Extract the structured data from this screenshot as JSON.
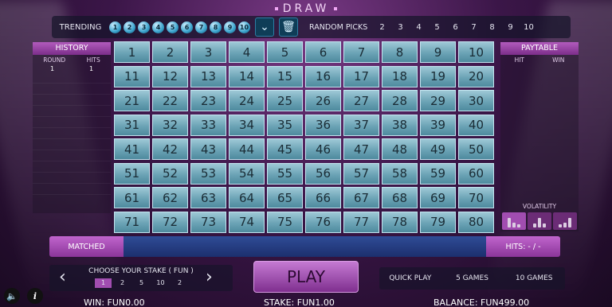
{
  "title": "DRAW",
  "trending": {
    "label": "TRENDING",
    "balls": [
      "1",
      "2",
      "3",
      "4",
      "5",
      "6",
      "7",
      "8",
      "9",
      "10"
    ]
  },
  "random_picks": {
    "label": "RANDOM PICKS",
    "options": [
      "2",
      "3",
      "4",
      "5",
      "6",
      "7",
      "8",
      "9",
      "10"
    ]
  },
  "history": {
    "title": "HISTORY",
    "col_round": "ROUND",
    "col_hits": "HITS",
    "round": "1",
    "hits": "1"
  },
  "paytable": {
    "title": "PAYTABLE",
    "col_hit": "HIT",
    "col_win": "WIN",
    "volatility_label": "VOLATILITY"
  },
  "grid": [
    "1",
    "2",
    "3",
    "4",
    "5",
    "6",
    "7",
    "8",
    "9",
    "10",
    "11",
    "12",
    "13",
    "14",
    "15",
    "16",
    "17",
    "18",
    "19",
    "20",
    "21",
    "22",
    "23",
    "24",
    "25",
    "26",
    "27",
    "28",
    "29",
    "30",
    "31",
    "32",
    "33",
    "34",
    "35",
    "36",
    "37",
    "38",
    "39",
    "40",
    "41",
    "42",
    "43",
    "44",
    "45",
    "46",
    "47",
    "48",
    "49",
    "50",
    "51",
    "52",
    "53",
    "54",
    "55",
    "56",
    "57",
    "58",
    "59",
    "60",
    "61",
    "62",
    "63",
    "64",
    "65",
    "66",
    "67",
    "68",
    "69",
    "70",
    "71",
    "72",
    "73",
    "74",
    "75",
    "76",
    "77",
    "78",
    "79",
    "80"
  ],
  "matched": {
    "label": "MATCHED",
    "hits_label": "HITS: - / -"
  },
  "stake": {
    "title": "CHOOSE YOUR STAKE ( FUN )",
    "options": [
      "1",
      "2",
      "5",
      "10",
      "2"
    ],
    "selected_index": 0
  },
  "play_label": "PLAY",
  "quick": {
    "quick_play": "QUICK PLAY",
    "five_games": "5 GAMES",
    "ten_games": "10 GAMES"
  },
  "footer": {
    "win": "WIN: FUN0.00",
    "stake": "STAKE: FUN1.00",
    "balance": "BALANCE: FUN499.00"
  }
}
